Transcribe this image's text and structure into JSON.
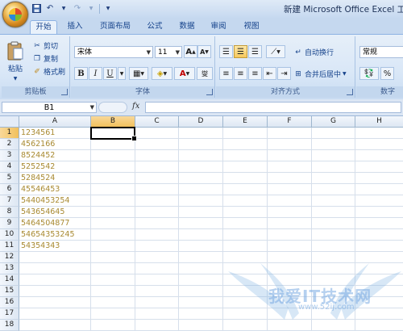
{
  "window": {
    "title": "新建 Microsoft Office Excel 工作表"
  },
  "quick_access": {
    "save_icon": "save-icon",
    "undo_icon": "undo-icon",
    "redo_icon": "redo-icon",
    "customize_icon": "customize-icon"
  },
  "tabs": [
    {
      "label": "开始",
      "active": true
    },
    {
      "label": "插入"
    },
    {
      "label": "页面布局"
    },
    {
      "label": "公式"
    },
    {
      "label": "数据"
    },
    {
      "label": "审阅"
    },
    {
      "label": "视图"
    }
  ],
  "ribbon": {
    "clipboard": {
      "label": "剪贴板",
      "paste": "粘贴",
      "cut": "剪切",
      "copy": "复制",
      "format_painter": "格式刷"
    },
    "font": {
      "label": "字体",
      "font_name": "宋体",
      "font_size": "11",
      "bold": "B",
      "italic": "I",
      "underline": "U",
      "grow": "A",
      "shrink": "A",
      "font_color": "A",
      "phonetic": "燮"
    },
    "alignment": {
      "label": "对齐方式",
      "wrap_text": "自动换行",
      "merge_center": "合并后居中"
    },
    "number": {
      "label": "数字",
      "format": "常规"
    }
  },
  "formula_bar": {
    "name_box": "B1",
    "fx": "fx",
    "content": ""
  },
  "columns": [
    "A",
    "B",
    "C",
    "D",
    "E",
    "F",
    "G",
    "H"
  ],
  "rows": [
    "1",
    "2",
    "3",
    "4",
    "5",
    "6",
    "7",
    "8",
    "9",
    "10",
    "11",
    "12",
    "13",
    "14",
    "15",
    "16",
    "17",
    "18"
  ],
  "cells_A": [
    "1234561",
    "4562166",
    "8524452",
    "5252542",
    "5284524",
    "45546453",
    "5440453254",
    "543654645",
    "5464504877",
    "54654353245",
    "54354343"
  ],
  "selected_cell": "B1",
  "watermark": {
    "text": "我爱IT技术网",
    "url": "www.52ij.com"
  },
  "colors": {
    "cell_text": "#a88930",
    "selection": "#000000",
    "header_selected": "#f1c05c"
  }
}
